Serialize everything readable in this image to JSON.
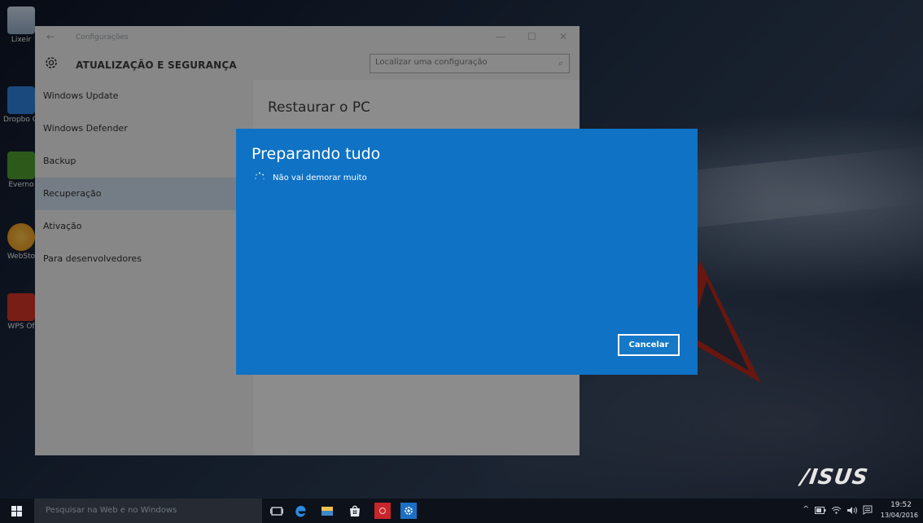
{
  "desktop": {
    "icons": [
      {
        "label": "Lixeir",
        "icon": "recycle-bin-icon",
        "color": "#9bb7d4"
      },
      {
        "label": "Dropbo GB",
        "icon": "dropbox-icon",
        "color": "#3d8be6"
      },
      {
        "label": "Everno",
        "icon": "evernote-icon",
        "color": "#5aa736"
      },
      {
        "label": "WebSto",
        "icon": "webstorage-icon",
        "color": "#f4a21c"
      },
      {
        "label": "WPS Of",
        "icon": "wps-office-icon",
        "color": "#d6392b"
      }
    ],
    "brand_logo": "/ISUS"
  },
  "settings_window": {
    "back_glyph": "←",
    "window_title": "Configurações",
    "controls": {
      "minimize": "—",
      "maximize": "☐",
      "close": "✕"
    },
    "header_title": "ATUALIZAÇÃO E SEGURANÇA",
    "search": {
      "placeholder": "Localizar uma configuração",
      "icon_glyph": "⌕"
    },
    "nav": [
      {
        "label": "Windows Update",
        "selected": false
      },
      {
        "label": "Windows Defender",
        "selected": false
      },
      {
        "label": "Backup",
        "selected": false
      },
      {
        "label": "Recuperação",
        "selected": true
      },
      {
        "label": "Ativação",
        "selected": false
      },
      {
        "label": "Para desenvolvedores",
        "selected": false
      }
    ],
    "content_title": "Restaurar o PC"
  },
  "dialog": {
    "title": "Preparando tudo",
    "subtitle": "Não vai demorar muito",
    "cancel_label": "Cancelar",
    "background": "#0f72c4"
  },
  "taskbar": {
    "search_placeholder": "Pesquisar na Web e no Windows",
    "apps": [
      {
        "icon": "task-view-icon"
      },
      {
        "icon": "edge-icon"
      },
      {
        "icon": "file-explorer-icon"
      },
      {
        "icon": "store-icon"
      },
      {
        "icon": "red-app-icon"
      },
      {
        "icon": "settings-app-icon"
      }
    ],
    "tray": {
      "chevron": "^",
      "time": "19:52",
      "date": "13/04/2016"
    }
  }
}
